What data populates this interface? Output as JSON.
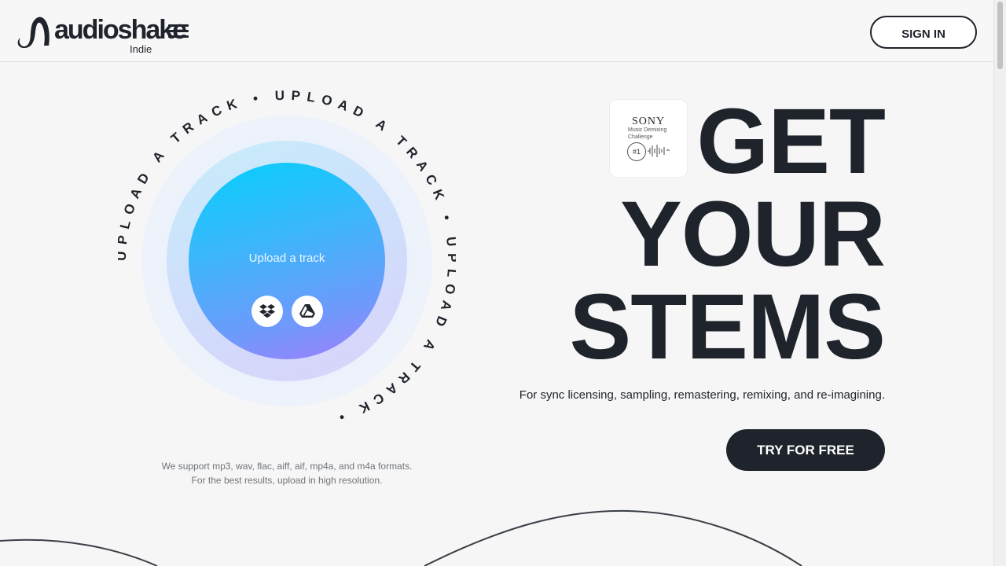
{
  "header": {
    "logo_word": "audioshake",
    "logo_sub": "Indie",
    "signin_label": "SIGN IN"
  },
  "upload": {
    "ring_text": "UPLOAD A TRACK • UPLOAD A TRACK • UPLOAD A TRACK • ",
    "label": "Upload a track",
    "formats_line1": "We support mp3, wav, flac, aiff, aif, mp4a, and m4a formats.",
    "formats_line2": "For the best results, upload in high resolution.",
    "sources": [
      "dropbox-icon",
      "google-drive-icon"
    ]
  },
  "badge": {
    "brand": "SONY",
    "line1": "Music Demixing",
    "line2": "Challenge",
    "rank": "#1"
  },
  "hero": {
    "line1": "GET",
    "line2": "YOUR",
    "line3": "STEMS",
    "tagline": "For sync licensing, sampling, remastering, remixing, and re-imagining.",
    "cta_label": "TRY FOR FREE"
  },
  "colors": {
    "primary_dark": "#1f232b",
    "gradient_top": "#05cffd",
    "gradient_bottom": "#a27dfc"
  }
}
